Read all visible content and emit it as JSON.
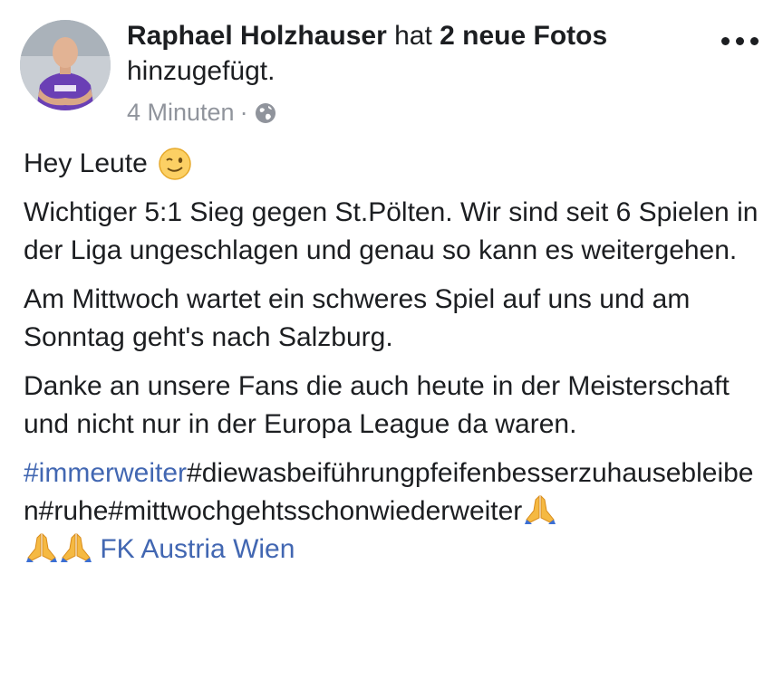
{
  "post": {
    "author": "Raphael Holzhauser",
    "action_prefix": "hat",
    "photos_count_text": "2 neue Fotos",
    "action_suffix": "hinzugefügt.",
    "timestamp": "4 Minuten",
    "separator": "·",
    "privacy_icon": "globe-icon",
    "menu_icon": "more-options-icon"
  },
  "body": {
    "greeting": "Hey Leute",
    "greeting_emoji": "winking-face-emoji",
    "paragraph_1": "Wichtiger 5:1 Sieg gegen St.Pölten. Wir sind seit 6 Spielen in der Liga ungeschlagen und genau so kann es weitergehen.",
    "paragraph_2": "Am Mittwoch wartet ein schweres Spiel auf uns und am Sonntag geht's nach Salzburg.",
    "paragraph_3": "Danke an unsere Fans die auch heute in der Meisterschaft und nicht nur in der Europa League da waren.",
    "hashtag_link": "#immerweiter",
    "hashtags_text": "#diewasbeiführungpfeifenbesserzuhauseblei­ben#ruhe#mittwochgehtsschonwiederweiter",
    "prayer_emoji": "folded-hands-emoji",
    "page_mention": "FK Austria Wien"
  },
  "colors": {
    "link": "#4267b2",
    "text": "#1c1e21",
    "meta": "#90949c"
  }
}
